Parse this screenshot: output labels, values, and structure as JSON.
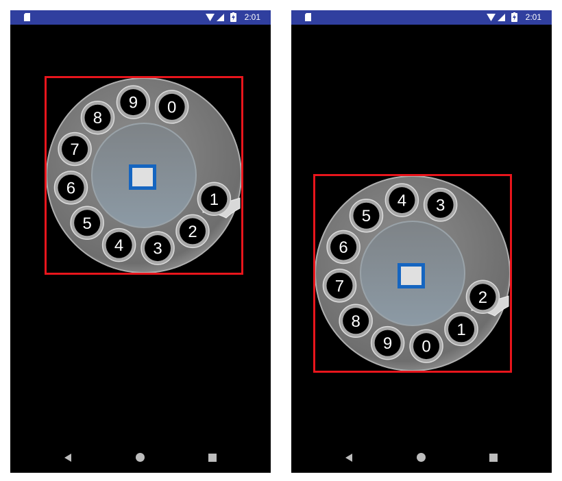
{
  "status_bar": {
    "time": "2:01",
    "background": "#303f9f",
    "icons": [
      "sd-card-icon",
      "wifi-icon",
      "signal-icon",
      "battery-charging-icon"
    ]
  },
  "nav_bar": {
    "icons": [
      "back-icon",
      "home-icon",
      "recents-icon"
    ]
  },
  "screens": [
    {
      "dial_labels_clockwise_from_right": [
        "1",
        "2",
        "3",
        "4",
        "5",
        "6",
        "7",
        "8",
        "9",
        "0"
      ],
      "highlight_color": "#e8151c"
    },
    {
      "dial_labels_clockwise_from_right": [
        "2",
        "1",
        "0",
        "9",
        "8",
        "7",
        "6",
        "5",
        "4",
        "3"
      ],
      "highlight_color": "#e8151c"
    }
  ],
  "center_button": {
    "border_color": "#1565c0",
    "fill_color": "#e0e0e0"
  }
}
